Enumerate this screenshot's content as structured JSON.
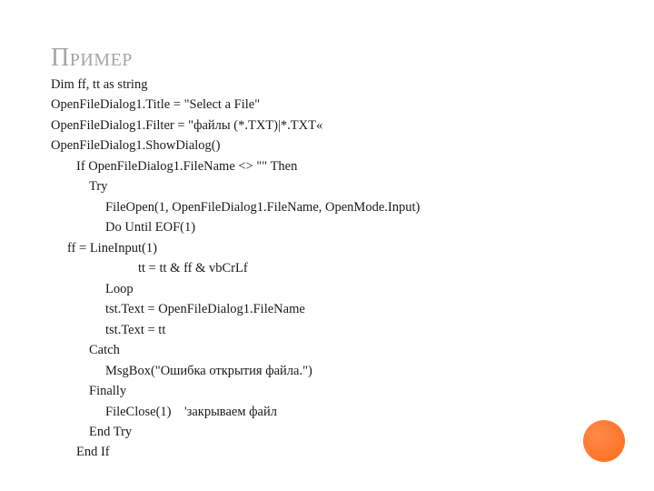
{
  "title": "Пример",
  "code": {
    "l1": "Dim ff, tt as string",
    "l2": "OpenFileDialog1.Title = \"Select a File\"",
    "l3": "OpenFileDialog1.Filter = \"файлы (*.TXT)|*.TXT«",
    "l4": "OpenFileDialog1.ShowDialog()",
    "l5": "If OpenFileDialog1.FileName <> \"\" Then",
    "l6": "Try",
    "l7": "FileOpen(1, OpenFileDialog1.FileName, OpenMode.Input)",
    "l8": "Do Until EOF(1)",
    "l9": "ff = LineInput(1)",
    "l10": "tt = tt & ff & vbCrLf",
    "l11": "Loop",
    "l12": "tst.Text = OpenFileDialog1.FileName",
    "l13": "tst.Text = tt",
    "l14": "Catch",
    "l15": "MsgBox(\"Ошибка открытия файла.\")",
    "l16": "Finally",
    "l17": "FileClose(1)    'закрываем файл",
    "l18": "End Try",
    "l19": "End If"
  }
}
